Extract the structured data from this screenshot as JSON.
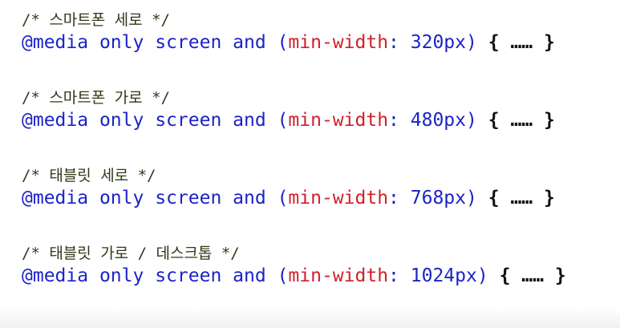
{
  "code_blocks": [
    {
      "comment": "/* 스마트폰 세로 */",
      "at_rule": "@media",
      "keyword_only": "only",
      "keyword_screen": "screen",
      "keyword_and": "and",
      "open_paren": "(",
      "property": "min-width",
      "colon": ":",
      "value": "320px",
      "close_paren": ")",
      "open_brace": "{",
      "ellipsis": "……",
      "close_brace": "}"
    },
    {
      "comment": "/* 스마트폰 가로 */",
      "at_rule": "@media",
      "keyword_only": "only",
      "keyword_screen": "screen",
      "keyword_and": "and",
      "open_paren": "(",
      "property": "min-width",
      "colon": ":",
      "value": "480px",
      "close_paren": ")",
      "open_brace": "{",
      "ellipsis": "……",
      "close_brace": "}"
    },
    {
      "comment": "/* 태블릿 세로 */",
      "at_rule": "@media",
      "keyword_only": "only",
      "keyword_screen": "screen",
      "keyword_and": "and",
      "open_paren": "(",
      "property": "min-width",
      "colon": ":",
      "value": "768px",
      "close_paren": ")",
      "open_brace": "{",
      "ellipsis": "……",
      "close_brace": "}"
    },
    {
      "comment": "/* 태블릿 가로 / 데스크톱 */",
      "at_rule": "@media",
      "keyword_only": "only",
      "keyword_screen": "screen",
      "keyword_and": "and",
      "open_paren": "(",
      "property": "min-width",
      "colon": ":",
      "value": "1024px",
      "close_paren": ")",
      "open_brace": "{",
      "ellipsis": "……",
      "close_brace": "}"
    }
  ],
  "colors": {
    "keyword": "#1b23c8",
    "property": "#d0202a",
    "comment": "#2d3a18",
    "brace": "#111111"
  }
}
